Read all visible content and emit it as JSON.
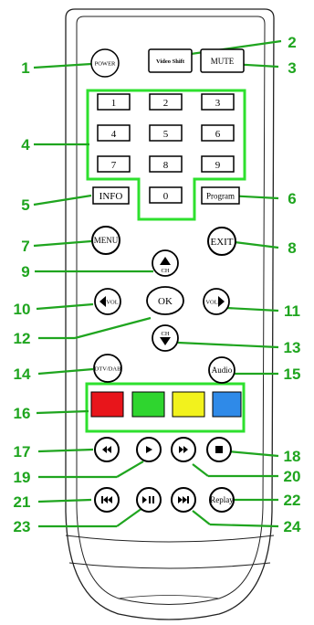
{
  "callouts": [
    "1",
    "2",
    "3",
    "4",
    "5",
    "6",
    "7",
    "8",
    "9",
    "10",
    "11",
    "12",
    "13",
    "14",
    "15",
    "16",
    "17",
    "18",
    "19",
    "20",
    "21",
    "22",
    "23",
    "24"
  ],
  "buttons": {
    "power": "POWER",
    "video_shift": "Video Shift",
    "mute": "MUTE",
    "digits": [
      "1",
      "2",
      "3",
      "4",
      "5",
      "6",
      "7",
      "8",
      "9",
      "0"
    ],
    "info": "INFO",
    "program": "Program",
    "menu": "MENU",
    "exit": "EXIT",
    "ok": "OK",
    "ch": "CH",
    "vol": "VOL",
    "dtv_dab": "DTV/DAB",
    "audio": "Audio",
    "replay": "Replay"
  },
  "colors": {
    "callout_green": "#1fa51f",
    "highlight_green": "#2ee02e",
    "color_keys": [
      "#e8151b",
      "#2fd52f",
      "#f2f21d",
      "#2f8ae8"
    ]
  }
}
